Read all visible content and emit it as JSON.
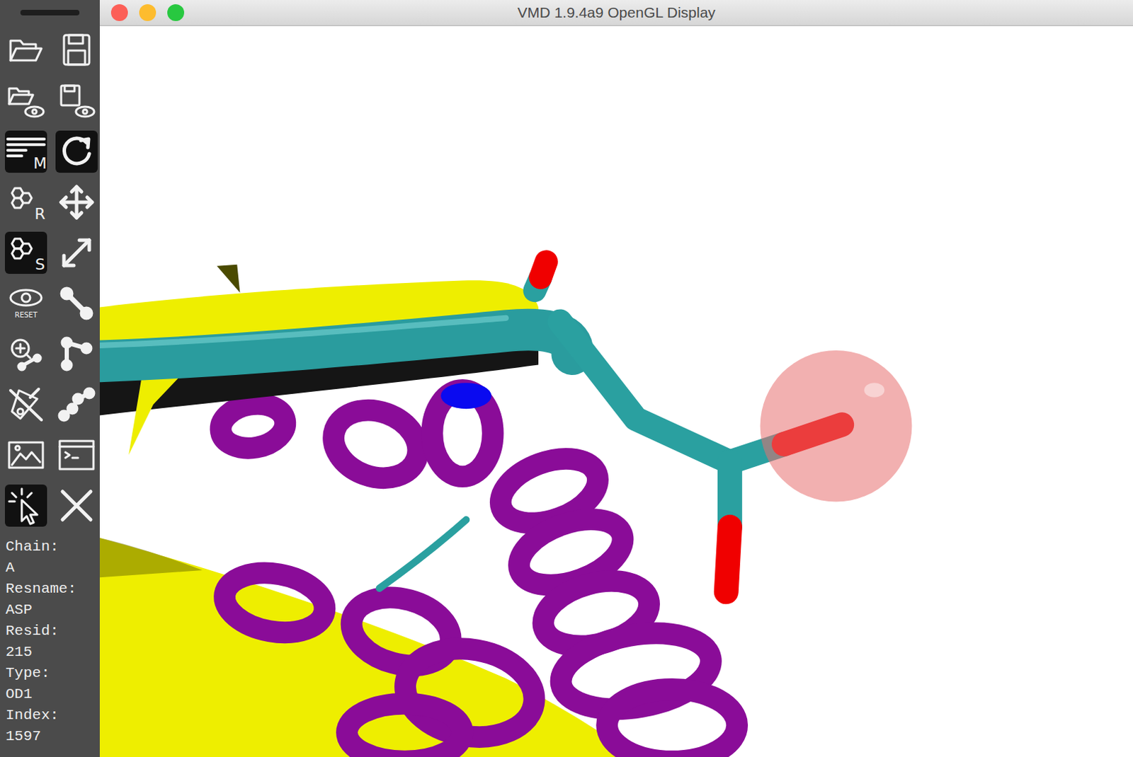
{
  "window": {
    "title": "VMD 1.9.4a9 OpenGL Display"
  },
  "toolbar": {
    "buttons": [
      {
        "kind": "open",
        "selected": false
      },
      {
        "kind": "save",
        "selected": false
      },
      {
        "kind": "open-view",
        "selected": false
      },
      {
        "kind": "save-view",
        "selected": false
      },
      {
        "kind": "main",
        "label": "M",
        "selected": true
      },
      {
        "kind": "rotate",
        "selected": true
      },
      {
        "kind": "reps",
        "label": "R",
        "selected": false
      },
      {
        "kind": "translate",
        "selected": false
      },
      {
        "kind": "selections",
        "label": "S",
        "selected": true
      },
      {
        "kind": "scale",
        "selected": false
      },
      {
        "kind": "reset",
        "label": "RESET",
        "selected": false
      },
      {
        "kind": "bond",
        "selected": false
      },
      {
        "kind": "query",
        "selected": false
      },
      {
        "kind": "angle",
        "selected": false
      },
      {
        "kind": "clear",
        "selected": false
      },
      {
        "kind": "dihedral",
        "selected": false
      },
      {
        "kind": "render",
        "selected": false
      },
      {
        "kind": "console",
        "selected": false
      },
      {
        "kind": "pick",
        "selected": true
      },
      {
        "kind": "close",
        "selected": false
      }
    ]
  },
  "picked_atom": [
    {
      "label": "Chain:",
      "value": "A"
    },
    {
      "label": "Resname:",
      "value": "ASP"
    },
    {
      "label": "Resid:",
      "value": "215"
    },
    {
      "label": "Type:",
      "value": "OD1"
    },
    {
      "label": "Index:",
      "value": "1597"
    }
  ]
}
